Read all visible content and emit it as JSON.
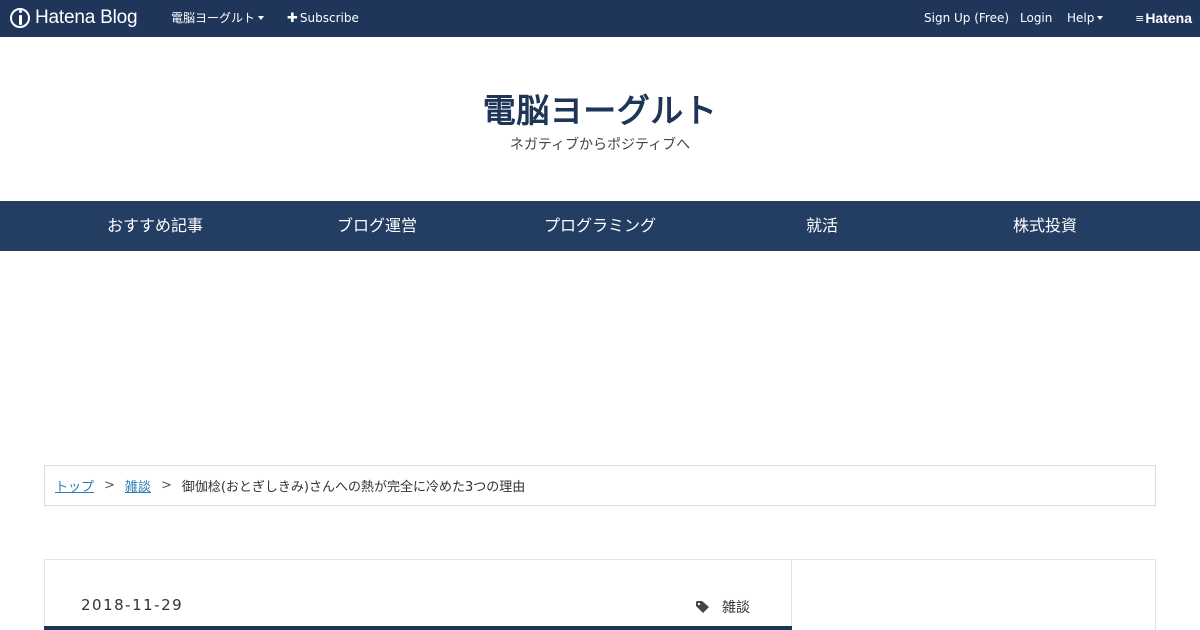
{
  "topbar": {
    "brand": "Hatena Blog",
    "blog_menu": "電脳ヨーグルト",
    "subscribe": "Subscribe",
    "signup": "Sign Up (Free)",
    "login": "Login",
    "help": "Help",
    "hatena": "Hatena"
  },
  "header": {
    "title": "電脳ヨーグルト",
    "description": "ネガティブからポジティブへ"
  },
  "nav": {
    "items": [
      "おすすめ記事",
      "ブログ運営",
      "プログラミング",
      "就活",
      "株式投資"
    ]
  },
  "breadcrumb": {
    "home": "トップ",
    "category": "雑談",
    "separator": ">",
    "current": "御伽棯(おとぎしきみ)さんへの熱が完全に冷めた3つの理由"
  },
  "article": {
    "date": "2018-11-29",
    "category": "雑談"
  },
  "colors": {
    "topbar": "#20355a",
    "nav": "#243d63",
    "title": "#1e3557",
    "link": "#2a7db6"
  }
}
